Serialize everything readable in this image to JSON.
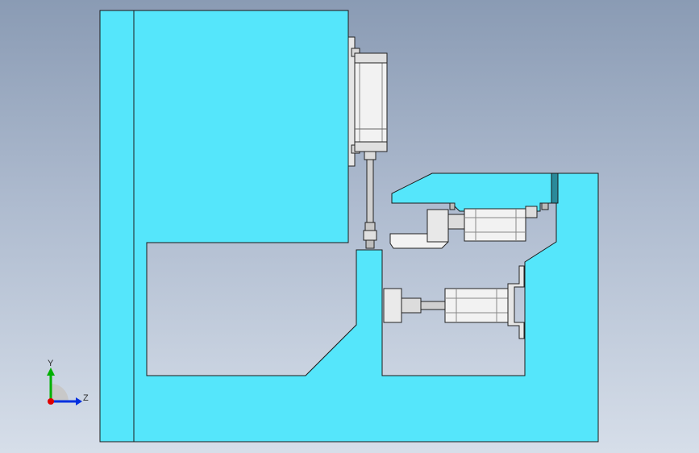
{
  "scene": {
    "description_colors": {
      "part_fill": "#55e6fb",
      "part_edge": "#1a1a1a",
      "cylinder_fill": "#f2f2f2",
      "bracket_fill": "#e6e6e6"
    }
  },
  "triad": {
    "y_label": "Y",
    "z_label": "Z",
    "x_color": "#e00000",
    "y_color": "#00b000",
    "z_color": "#0030e0"
  }
}
